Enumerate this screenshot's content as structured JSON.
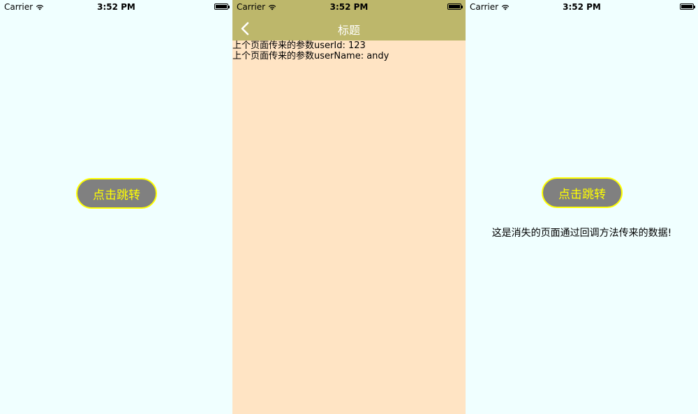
{
  "status_bar": {
    "carrier": "Carrier",
    "time": "3:52 PM",
    "battery_level": 1.0
  },
  "screen1": {
    "button_label": "点击跳转"
  },
  "screen2": {
    "nav_title": "标题",
    "back_icon": "chevron-left-icon",
    "params": [
      "上个页面传来的参数userId: 123",
      "上个页面传来的参数userName: andy"
    ]
  },
  "screen3": {
    "button_label": "点击跳转",
    "callback_message": "这是消失的页面通过回调方法传来的数据!"
  },
  "colors": {
    "screen_bg": "#f0ffff",
    "detail_bg": "#ffe4c4",
    "nav_bg": "#bdb76b",
    "button_bg": "#808080",
    "button_accent": "#ffff00"
  }
}
